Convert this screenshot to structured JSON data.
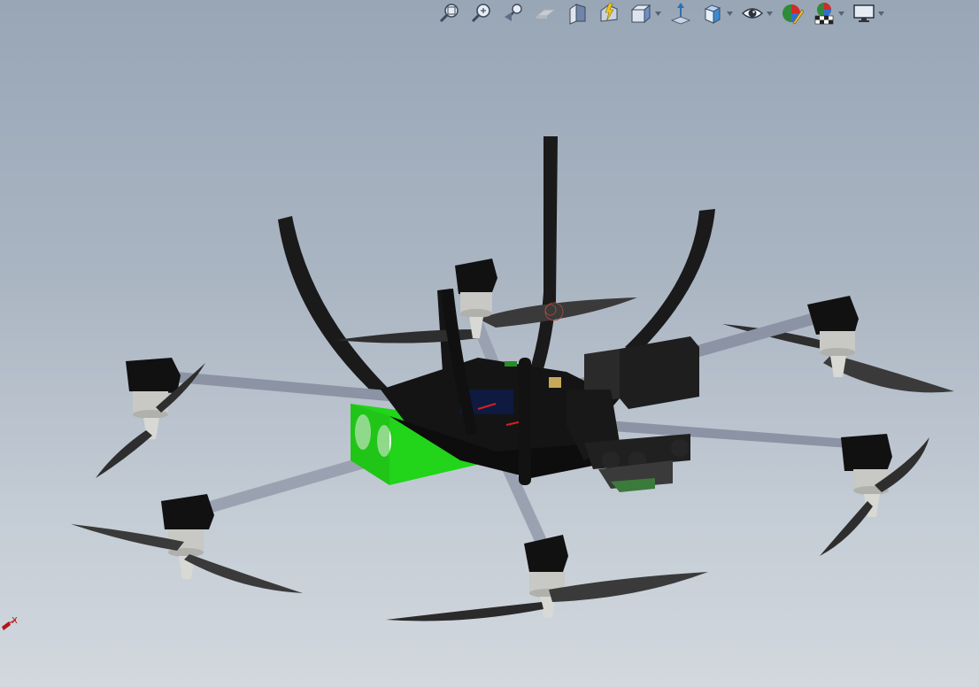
{
  "window": {
    "background_top": "#98a6b6",
    "background_bottom": "#d2d8de"
  },
  "toolbar": {
    "buttons": [
      {
        "name": "zoom-to-fit-button",
        "icon": "zoom-to-fit-icon",
        "dropdown": false
      },
      {
        "name": "zoom-to-area-button",
        "icon": "zoom-to-area-icon",
        "dropdown": false
      },
      {
        "name": "previous-view-button",
        "icon": "previous-view-icon",
        "dropdown": false
      },
      {
        "name": "section-view-button",
        "icon": "section-view-icon",
        "dropdown": false,
        "disabled": true
      },
      {
        "name": "dynamic-annotation-views-button",
        "icon": "section-plane-icon",
        "dropdown": false
      },
      {
        "name": "instant3d-button",
        "icon": "instant3d-icon",
        "dropdown": false
      },
      {
        "name": "view-orientation-button",
        "icon": "view-orientation-icon",
        "dropdown": true
      },
      {
        "name": "view-triad-button",
        "icon": "triad-arrow-icon",
        "dropdown": false
      },
      {
        "name": "display-style-button",
        "icon": "display-style-cube-icon",
        "dropdown": true
      },
      {
        "name": "hide-show-items-button",
        "icon": "eye-icon",
        "dropdown": true
      },
      {
        "name": "edit-appearance-button",
        "icon": "appearance-ball-icon",
        "dropdown": false
      },
      {
        "name": "apply-scene-button",
        "icon": "scene-icon",
        "dropdown": true
      },
      {
        "name": "view-settings-button",
        "icon": "monitor-icon",
        "dropdown": true
      }
    ]
  },
  "model": {
    "name": "octocopter-assembly",
    "frame_color": "#1a1a1a",
    "arm_color": "#8c93a4",
    "battery_color": "#22d41a",
    "motor_color": "#c8c8c4"
  },
  "triad": {
    "x_label": "X",
    "x_color": "#b4141a"
  }
}
